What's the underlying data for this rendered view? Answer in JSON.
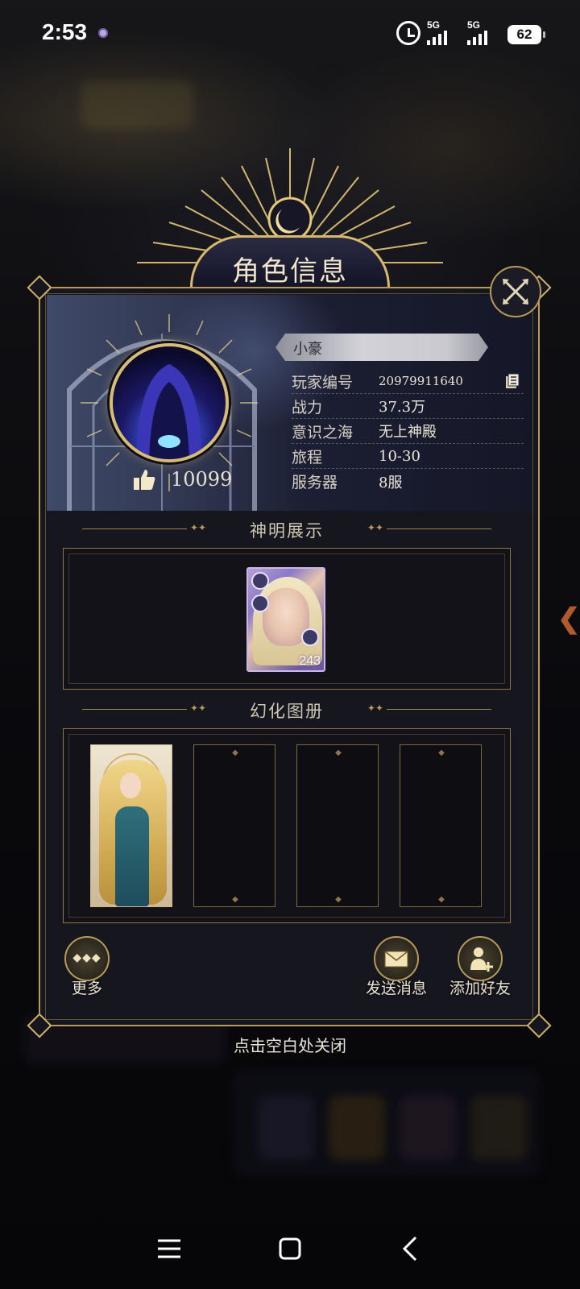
{
  "status_bar": {
    "time": "2:53",
    "network_1": "5G",
    "network_2": "5G",
    "battery": "62"
  },
  "dialog": {
    "title": "角色信息",
    "player": {
      "name": "小豪",
      "likes": "10099",
      "fields": [
        {
          "label": "玩家编号",
          "value": "20979911640"
        },
        {
          "label": "战力",
          "value": "37.3万"
        },
        {
          "label": "意识之海",
          "value": "无上神殿"
        },
        {
          "label": "旅程",
          "value": "10-30"
        },
        {
          "label": "服务器",
          "value": "8服"
        }
      ]
    },
    "sections": {
      "gods": {
        "title": "神明展示",
        "card_level": "243"
      },
      "album": {
        "title": "幻化图册",
        "slots_filled": 1,
        "slots_total": 4
      }
    },
    "actions": {
      "more": "更多",
      "send_message": "发送消息",
      "add_friend": "添加好友"
    },
    "close_hint": "点击空白处关闭"
  },
  "icons": {
    "close": "close-x-icon",
    "like": "thumbs-up-icon",
    "copy": "copy-icon",
    "more": "three-diamonds-icon",
    "send_message": "envelope-icon",
    "add_friend": "add-person-icon"
  },
  "colors": {
    "gold": "#d8b96c",
    "panel_bg": "#16161e",
    "text": "#e9e2d2"
  }
}
